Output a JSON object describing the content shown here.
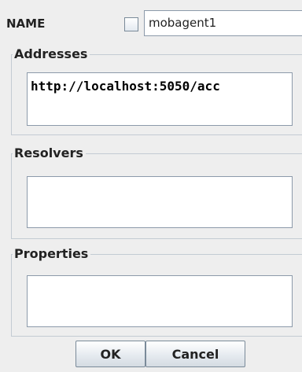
{
  "name_row": {
    "label": "NAME",
    "checkbox_checked": false,
    "value": "mobagent1"
  },
  "addresses": {
    "legend": "Addresses",
    "text": "http://localhost:5050/acc"
  },
  "resolvers": {
    "legend": "Resolvers",
    "text": ""
  },
  "properties": {
    "legend": "Properties",
    "text": ""
  },
  "buttons": {
    "ok": "OK",
    "cancel": "Cancel"
  }
}
